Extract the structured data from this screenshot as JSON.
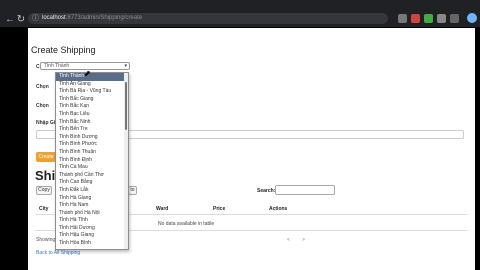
{
  "browser": {
    "url_host": "localhost",
    "url_path": ":8773/admin/Shipping/create",
    "nav_back_icon": "arrow-left-icon",
    "nav_forward_icon": "arrow-right-icon",
    "reload_icon": "reload-icon"
  },
  "page": {
    "title": "Create Shipping",
    "labels": [
      "Chọn",
      "Chọn",
      "Chọn",
      "Nhập Gi"
    ],
    "select_value": "Tỉnh Thành",
    "submit_label": "Create",
    "section_title": "Shipp",
    "toolbar_buttons": [
      "Copy",
      "to"
    ],
    "search_label": "Search:",
    "columns": [
      "City",
      "Ward",
      "Price",
      "Actions"
    ],
    "empty_message": "No data available in table",
    "info_text": "Showing",
    "back_link": "Back to All Shipping",
    "pager": [
      "<",
      ">"
    ]
  },
  "dropdown": {
    "selected_index": 0,
    "items": [
      "Tỉnh Thành",
      "Tỉnh An Giang",
      "Tỉnh Bà Rịa - Vũng Tàu",
      "Tỉnh Bắc Giang",
      "Tỉnh Bắc Kạn",
      "Tỉnh Bạc Liêu",
      "Tỉnh Bắc Ninh",
      "Tỉnh Bến Tre",
      "Tỉnh Bình Dương",
      "Tỉnh Bình Phước",
      "Tỉnh Bình Thuận",
      "Tỉnh Bình Định",
      "Tỉnh Cà Mau",
      "Thành phố Cần Thơ",
      "Tỉnh Cao Bằng",
      "Tỉnh Đắk Lắk",
      "Tỉnh Hà Giang",
      "Tỉnh Hà Nam",
      "Thành phố Hà Nội",
      "Tỉnh Hà Tĩnh",
      "Tỉnh Hải Dương",
      "Tỉnh Hậu Giang",
      "Tỉnh Hòa Bình"
    ]
  },
  "colors": {
    "chrome_bg": "#202124",
    "submit_button": "#f0a030",
    "selected_item": "#5a6e8a",
    "link": "#3a7bd5"
  }
}
